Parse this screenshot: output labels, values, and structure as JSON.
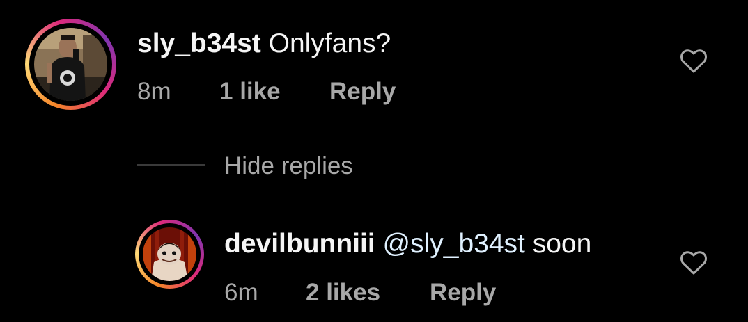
{
  "comments": [
    {
      "username": "sly_b34st",
      "text": "Onlyfans?",
      "time": "8m",
      "likes": "1 like",
      "reply_label": "Reply"
    }
  ],
  "hide_replies_label": "Hide replies",
  "replies": [
    {
      "username": "devilbunniii",
      "mention": "@sly_b34st",
      "text": "soon",
      "time": "6m",
      "likes": "2 likes",
      "reply_label": "Reply"
    }
  ],
  "icons": {
    "like": "heart-outline-icon"
  },
  "colors": {
    "background": "#000000",
    "primary_text": "#f5f5f5",
    "secondary_text": "#a8a8a8",
    "mention": "#e0f1ff",
    "story_ring": [
      "#f58529",
      "#feda77",
      "#dd2a7b",
      "#8134af"
    ]
  }
}
